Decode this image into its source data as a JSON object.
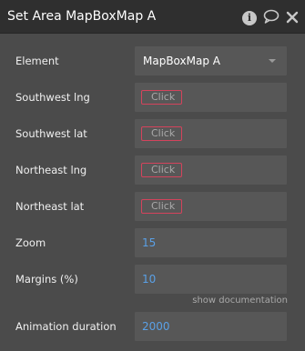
{
  "header": {
    "title": "Set Area MapBoxMap A",
    "icons": [
      "info-icon",
      "comment-icon",
      "close-icon"
    ]
  },
  "fields": [
    {
      "label": "Element",
      "type": "dropdown",
      "value": "MapBoxMap A"
    },
    {
      "label": "Southwest lng",
      "type": "click",
      "button": "Click"
    },
    {
      "label": "Southwest lat",
      "type": "click",
      "button": "Click"
    },
    {
      "label": "Northeast lng",
      "type": "click",
      "button": "Click"
    },
    {
      "label": "Northeast lat",
      "type": "click",
      "button": "Click"
    },
    {
      "label": "Zoom",
      "type": "value",
      "value": "15"
    },
    {
      "label": "Margins (%)",
      "type": "value",
      "value": "10"
    },
    {
      "label": "Animation duration",
      "type": "value",
      "value": "2000"
    }
  ],
  "show_documentation": "show documentation"
}
